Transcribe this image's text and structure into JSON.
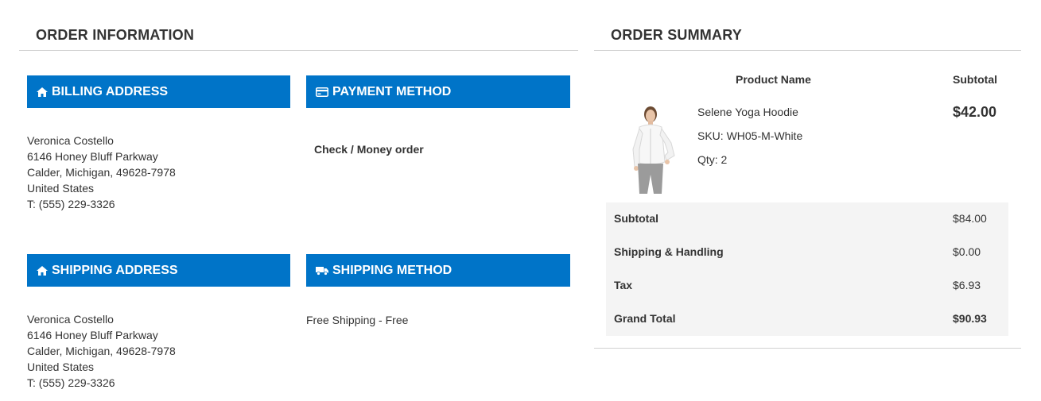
{
  "order_information": {
    "title": "ORDER INFORMATION",
    "billing_address": {
      "heading": "BILLING ADDRESS",
      "icon": "home-icon",
      "lines": [
        "Veronica Costello",
        "6146 Honey Bluff Parkway",
        "Calder, Michigan, 49628-7978",
        "United States",
        "T: (555) 229-3326"
      ]
    },
    "payment_method": {
      "heading": "PAYMENT METHOD",
      "icon": "credit-card-icon",
      "value": "Check / Money order"
    },
    "shipping_address": {
      "heading": "SHIPPING ADDRESS",
      "icon": "home-icon",
      "lines": [
        "Veronica Costello",
        "6146 Honey Bluff Parkway",
        "Calder, Michigan, 49628-7978",
        "United States",
        "T: (555) 229-3326"
      ]
    },
    "shipping_method": {
      "heading": "SHIPPING METHOD",
      "icon": "truck-icon",
      "value": "Free Shipping - Free"
    }
  },
  "order_summary": {
    "title": "ORDER SUMMARY",
    "columns": {
      "product": "Product Name",
      "subtotal": "Subtotal"
    },
    "item": {
      "name": "Selene Yoga Hoodie",
      "sku": "SKU: WH05-M-White",
      "qty": "Qty: 2",
      "price": "$42.00"
    },
    "totals": [
      {
        "label": "Subtotal",
        "value": "$84.00"
      },
      {
        "label": "Shipping & Handling",
        "value": "$0.00"
      },
      {
        "label": "Tax",
        "value": "$6.93"
      },
      {
        "label": "Grand Total",
        "value": "$90.93"
      }
    ]
  },
  "colors": {
    "accent": "#0074c8",
    "totals_bg": "#f4f4f4",
    "rule": "#d1d1d1",
    "text": "#333333"
  }
}
